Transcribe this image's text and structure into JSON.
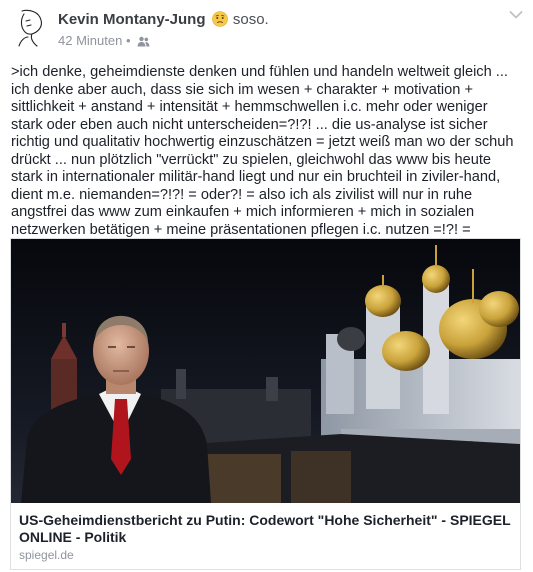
{
  "post": {
    "author_name": "Kevin Montany-Jung",
    "feeling_icon": "worried-face-emoji",
    "feeling_text": "soso.",
    "timestamp": "42 Minuten",
    "separator": "•",
    "audience_icon": "friends-icon",
    "menu_icon": "chevron-down-icon",
    "text": ">ich denke, geheimdienste denken und fühlen und handeln weltweit gleich ... ich denke aber auch, dass sie sich im wesen + charakter + motivation + sittlichkeit + anstand + intensität + hemmschwellen  i.c. mehr oder weniger stark oder eben auch nicht unterscheiden=?!?! ... die us-analyse ist sicher richtig und qualitativ hochwertig einzuschätzen = jetzt weiß man wo der schuh drückt ... nun plötzlich \"verrückt\" zu spielen,  gleichwohl das www bis heute stark in internationaler militär-hand liegt und nur ein bruchteil in ziviler-hand, dient m.e. niemanden=?!?! = oder?! = also ich als zivilist will nur in ruhe angstfrei das www zum einkaufen + mich informieren + mich in sozialen netzwerken betätigen + meine präsentationen pflegen i.c. nutzen =!?! = oder=?!?!<<"
  },
  "link": {
    "title": "US-Geheimdienstbericht zu Putin: Codewort \"Hohe Sicherheit\" - SPIEGEL ONLINE - Politik",
    "domain": "spiegel.de",
    "image_description_icon": "news-photo"
  },
  "colors": {
    "name": "#3b3e44",
    "meta": "#90949c",
    "border": "#dddfe2",
    "tie": "#b0141c",
    "gold": "#c9a23a"
  }
}
